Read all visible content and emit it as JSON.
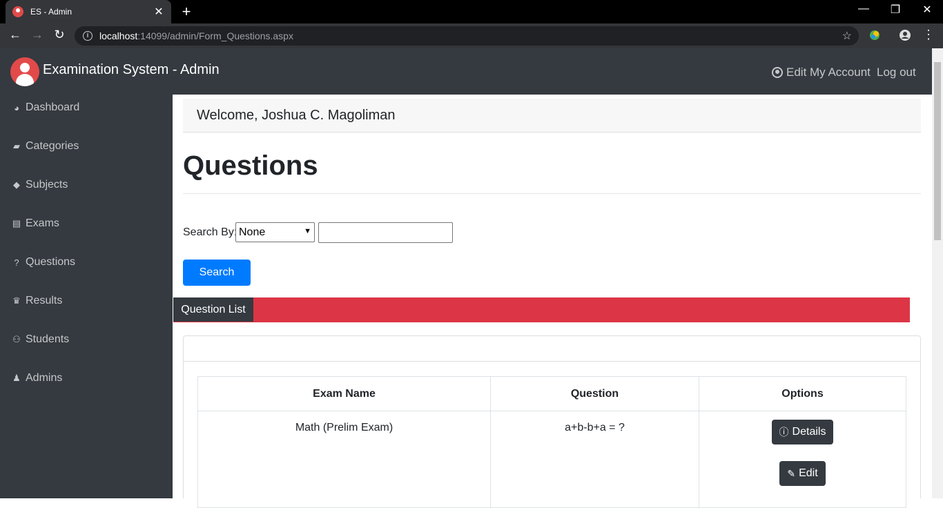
{
  "browser": {
    "tab_title": "ES - Admin",
    "url_host": "localhost",
    "url_path": ":14099/admin/Form_Questions.aspx"
  },
  "header": {
    "brand": "Examination System - Admin",
    "edit_account": "Edit My Account",
    "logout": "Log out"
  },
  "sidebar": {
    "items": [
      {
        "label": "Dashboard",
        "icon": "dashboard-icon"
      },
      {
        "label": "Categories",
        "icon": "folder-icon"
      },
      {
        "label": "Subjects",
        "icon": "tag-icon"
      },
      {
        "label": "Exams",
        "icon": "book-icon"
      },
      {
        "label": "Questions",
        "icon": "question-circle-icon"
      },
      {
        "label": "Results",
        "icon": "trophy-icon"
      },
      {
        "label": "Students",
        "icon": "users-icon"
      },
      {
        "label": "Admins",
        "icon": "user-secret-icon"
      }
    ]
  },
  "main": {
    "welcome": "Welcome, Joshua C. Magoliman",
    "title": "Questions",
    "search_label": "Search By:",
    "search_select": "None",
    "search_value": "",
    "search_button": "Search",
    "list_tag": "Question List"
  },
  "table": {
    "headers": [
      "Exam Name",
      "Question",
      "Options"
    ],
    "rows": [
      {
        "exam": "Math (Prelim Exam)",
        "question": "a+b-b+a = ?",
        "details": "Details",
        "edit": "Edit"
      }
    ]
  },
  "colors": {
    "sidebar_bg": "#343a40",
    "primary": "#007bff",
    "danger": "#dc3545"
  }
}
